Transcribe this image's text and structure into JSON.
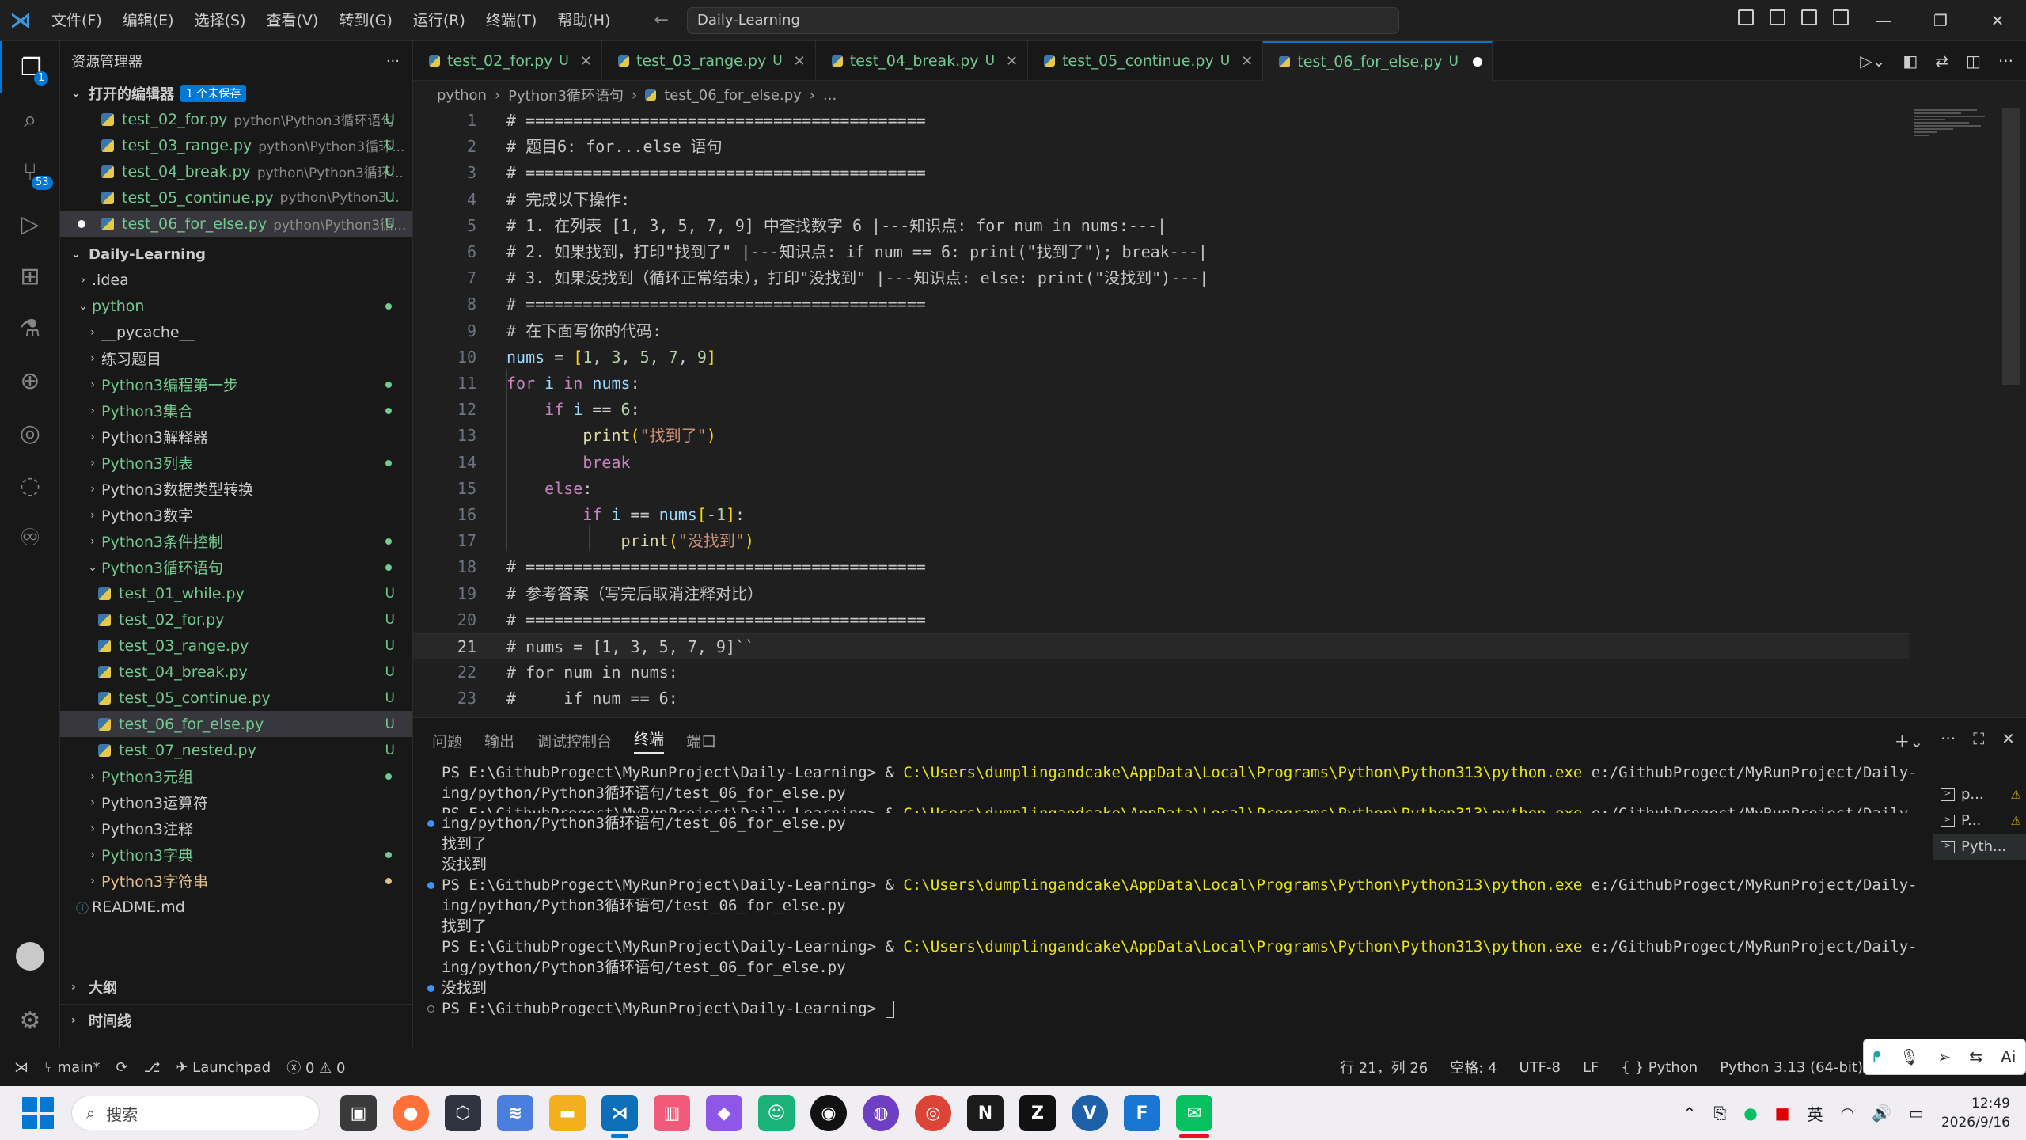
{
  "titlebar": {
    "menu": [
      "文件(F)",
      "编辑(E)",
      "选择(S)",
      "查看(V)",
      "转到(G)",
      "运行(R)",
      "终端(T)",
      "帮助(H)"
    ],
    "search": "Daily-Learning"
  },
  "activity": {
    "scm_badge": "53",
    "explorer_badge": "1"
  },
  "sidebar": {
    "title": "资源管理器",
    "open_editors": {
      "label": "打开的编辑器",
      "unsaved": "1 个未保存",
      "items": [
        {
          "name": "test_02_for.py",
          "path": "python\\Python3循环语句",
          "status": "U"
        },
        {
          "name": "test_03_range.py",
          "path": "python\\Python3循环...",
          "status": "U"
        },
        {
          "name": "test_04_break.py",
          "path": "python\\Python3循环...",
          "status": "U"
        },
        {
          "name": "test_05_continue.py",
          "path": "python\\Python3...",
          "status": "U"
        },
        {
          "name": "test_06_for_else.py",
          "path": "python\\Python3循...",
          "status": "U"
        }
      ]
    },
    "workspace": "Daily-Learning",
    "tree": {
      "idea": ".idea",
      "python": "python",
      "folders": [
        "__pycache__",
        "练习题目",
        "Python3编程第一步",
        "Python3集合",
        "Python3解释器",
        "Python3列表",
        "Python3数据类型转换",
        "Python3数字",
        "Python3条件控制",
        "Python3循环语句"
      ],
      "loop_files": [
        "test_01_while.py",
        "test_02_for.py",
        "test_03_range.py",
        "test_04_break.py",
        "test_05_continue.py",
        "test_06_for_else.py",
        "test_07_nested.py"
      ],
      "folders_after": [
        "Python3元组",
        "Python3运算符",
        "Python3注释",
        "Python3字典",
        "Python3字符串"
      ],
      "readme": "README.md",
      "status_u": "U"
    },
    "outline": "大纲",
    "timeline": "时间线"
  },
  "tabs": [
    {
      "label": "test_02_for.py",
      "status": "U"
    },
    {
      "label": "test_03_range.py",
      "status": "U"
    },
    {
      "label": "test_04_break.py",
      "status": "U"
    },
    {
      "label": "test_05_continue.py",
      "status": "U"
    },
    {
      "label": "test_06_for_else.py",
      "status": "U"
    }
  ],
  "breadcrumb": [
    "python",
    "Python3循环语句",
    "test_06_for_else.py",
    "..."
  ],
  "editor": {
    "line_numbers": [
      "1",
      "2",
      "3",
      "4",
      "5",
      "6",
      "7",
      "8",
      "9",
      "10",
      "11",
      "12",
      "13",
      "14",
      "15",
      "16",
      "17",
      "18",
      "19",
      "20",
      "21",
      "22",
      "23"
    ],
    "lines": [
      "# ==========================================",
      "# 题目6: for...else 语句",
      "# ==========================================",
      "# 完成以下操作:",
      "# 1. 在列表 [1, 3, 5, 7, 9] 中查找数字 6 |---知识点: for num in nums:---|",
      "# 2. 如果找到，打印\"找到了\" |---知识点: if num == 6: print(\"找到了\"); break---|",
      "# 3. 如果没找到（循环正常结束），打印\"没找到\" |---知识点: else: print(\"没找到\")---|",
      "# ==========================================",
      "# 在下面写你的代码:",
      "nums = [1, 3, 5, 7, 9]",
      "for i in nums:",
      "    if i == 6:",
      "        print(\"找到了\")",
      "        break",
      "    else:",
      "        if i == nums[-1]:",
      "            print(\"没找到\")",
      "# ==========================================",
      "# 参考答案（写完后取消注释对比）",
      "# ==========================================",
      "# nums = [1, 3, 5, 7, 9]``",
      "# for num in nums:",
      "#     if num == 6:"
    ]
  },
  "panel": {
    "tabs": [
      "问题",
      "输出",
      "调试控制台",
      "终端",
      "端口"
    ],
    "terminal": {
      "prompt": "PS E:\\GithubProgect\\MyRunProject\\Daily-Learning> ",
      "amp": "& ",
      "exe": "C:\\Users\\dumplingandcake\\AppData\\Local\\Programs\\Python\\Python313\\python.exe",
      "arg1": " e:/GithubProgect/MyRunProject/Daily-Learn",
      "arg2": "ing/python/Python3循环语句/test_06_for_else.py",
      "found": "找到了",
      "notfound": "没找到"
    },
    "terminal_list": [
      "p...",
      "P...",
      "Pyth..."
    ]
  },
  "status": {
    "branch": "main*",
    "launchpad": "Launchpad",
    "errors": "0",
    "warnings": "0",
    "position": "行 21，列 26",
    "spaces": "空格: 4",
    "encoding": "UTF-8",
    "eol": "LF",
    "language": "Python",
    "interpreter": "Python 3.13 (64-bit)"
  },
  "taskbar": {
    "search": "搜索",
    "ime": "英",
    "time": "12:49",
    "date": "2026/9/16"
  }
}
